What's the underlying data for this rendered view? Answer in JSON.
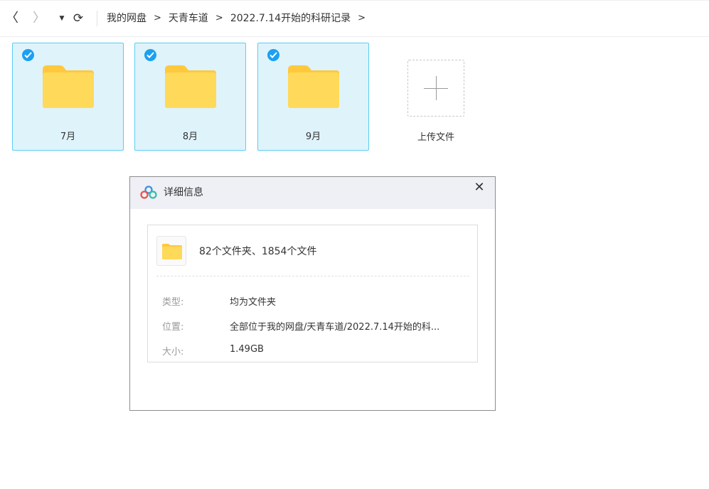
{
  "toolbar": {
    "back_icon": "chevron-left-icon",
    "forward_icon": "chevron-right-icon",
    "dropdown_icon": "caret-down-icon",
    "refresh_icon": "refresh-icon",
    "back_glyph": "〈",
    "forward_glyph": "〉",
    "dropdown_glyph": "▼",
    "refresh_glyph": "⟳"
  },
  "breadcrumb": {
    "items": [
      "我的网盘",
      "天青车道",
      "2022.7.14开始的科研记录"
    ],
    "separator": ">"
  },
  "folders": [
    {
      "label": "7月",
      "selected": true
    },
    {
      "label": "8月",
      "selected": true
    },
    {
      "label": "9月",
      "selected": true
    }
  ],
  "upload": {
    "label": "上传文件"
  },
  "dialog": {
    "title": "详细信息",
    "close_glyph": "✕",
    "summary": "82个文件夹、1854个文件",
    "rows": [
      {
        "key": "类型:",
        "value": "均为文件夹"
      },
      {
        "key": "位置:",
        "value": "全部位于我的网盘/天青车道/2022.7.14开始的科..."
      },
      {
        "key": "大小:",
        "value": "1.49GB"
      }
    ]
  },
  "colors": {
    "selection_bg": "#dff3fb",
    "selection_border": "#5ccdf3",
    "check_blue": "#1ba0f2",
    "folder_yellow": "#ffd54f",
    "folder_tab": "#ffc83d"
  }
}
